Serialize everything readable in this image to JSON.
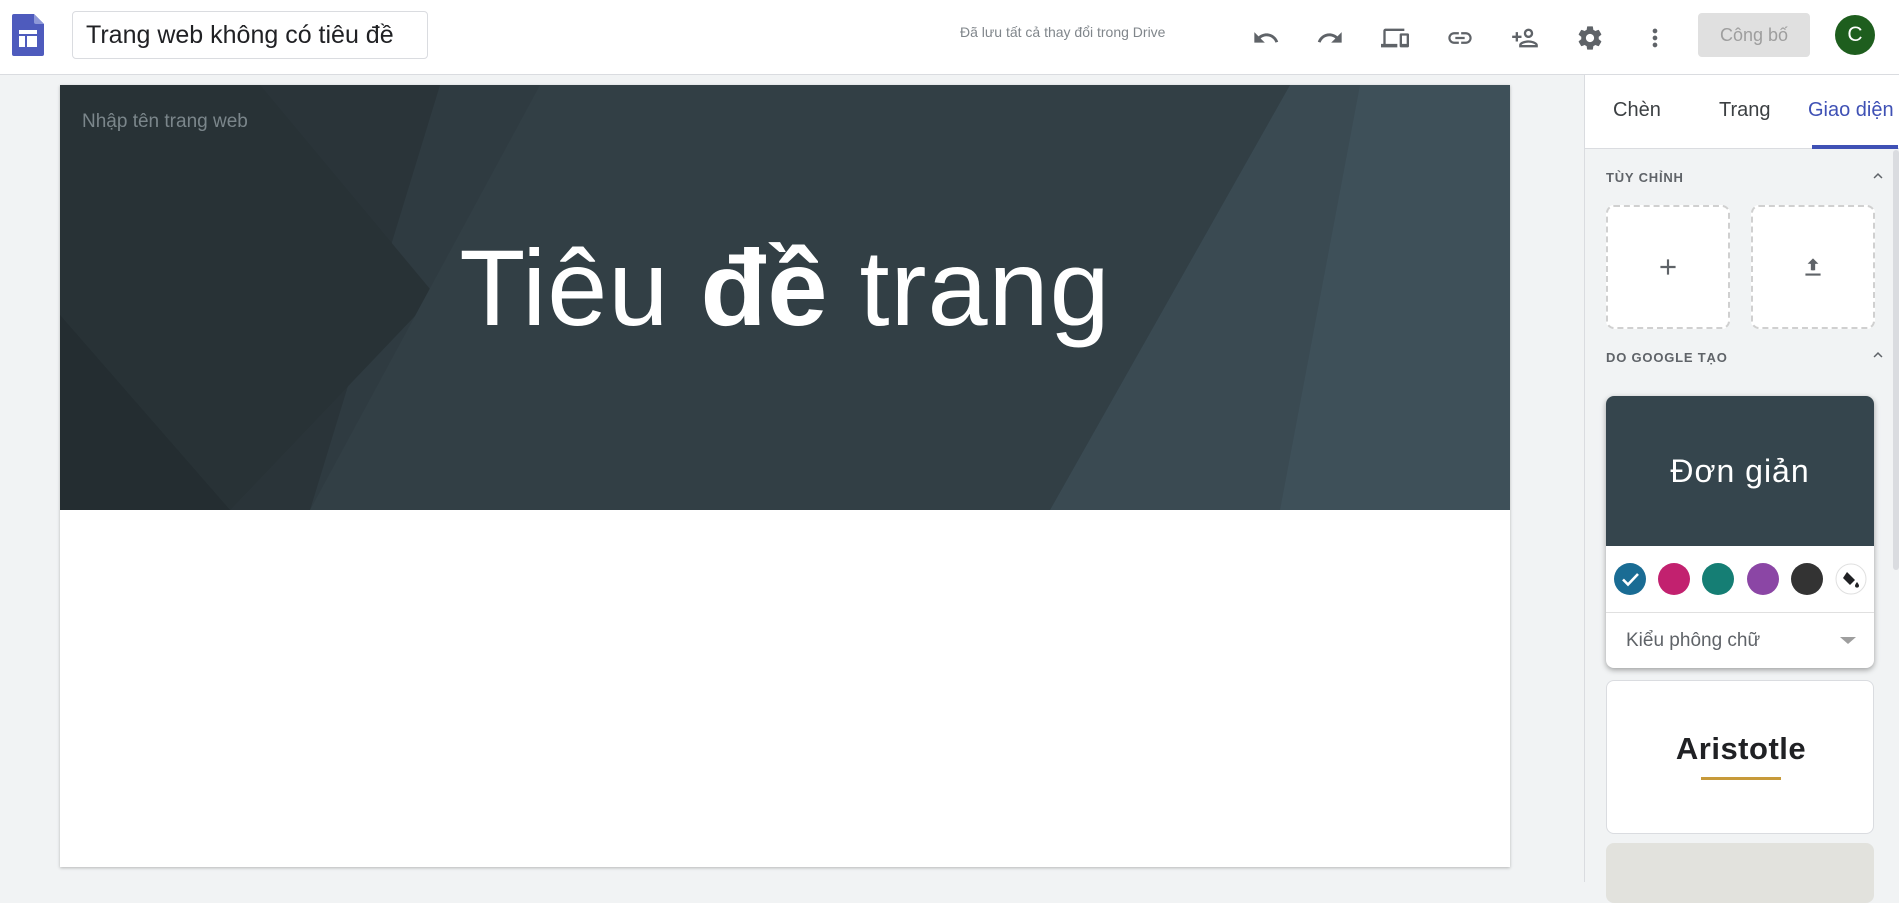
{
  "header": {
    "doc_title": "Trang web không có tiêu đề",
    "save_status": "Đã lưu tất cả thay đổi trong Drive",
    "publish_label": "Công bố",
    "avatar_letter": "C"
  },
  "toolbar_icons": [
    "undo-icon",
    "redo-icon",
    "preview-devices-icon",
    "link-icon",
    "share-person-icon",
    "settings-icon",
    "more-vert-icon"
  ],
  "canvas": {
    "site_name_placeholder": "Nhập tên trang web",
    "title_part1": "Tiêu ",
    "title_bold": "đề",
    "title_part2": " trang",
    "header_bg": "#2f3b41"
  },
  "panel": {
    "tabs": [
      "Chèn",
      "Trang",
      "Giao diện"
    ],
    "active_tab": "Giao diện",
    "accent": "#3f51b5",
    "custom_section": "TÙY CHỈNH",
    "google_section": "DO GOOGLE TẠO",
    "themes": [
      {
        "name": "Đơn giản",
        "swatch_colors": [
          "#1a6c94",
          "#c2216f",
          "#157e74",
          "#8b46a5",
          "#333333"
        ],
        "selected_swatch": 0,
        "font_select_label": "Kiểu phông chữ"
      },
      {
        "name": "Aristotle"
      }
    ]
  }
}
